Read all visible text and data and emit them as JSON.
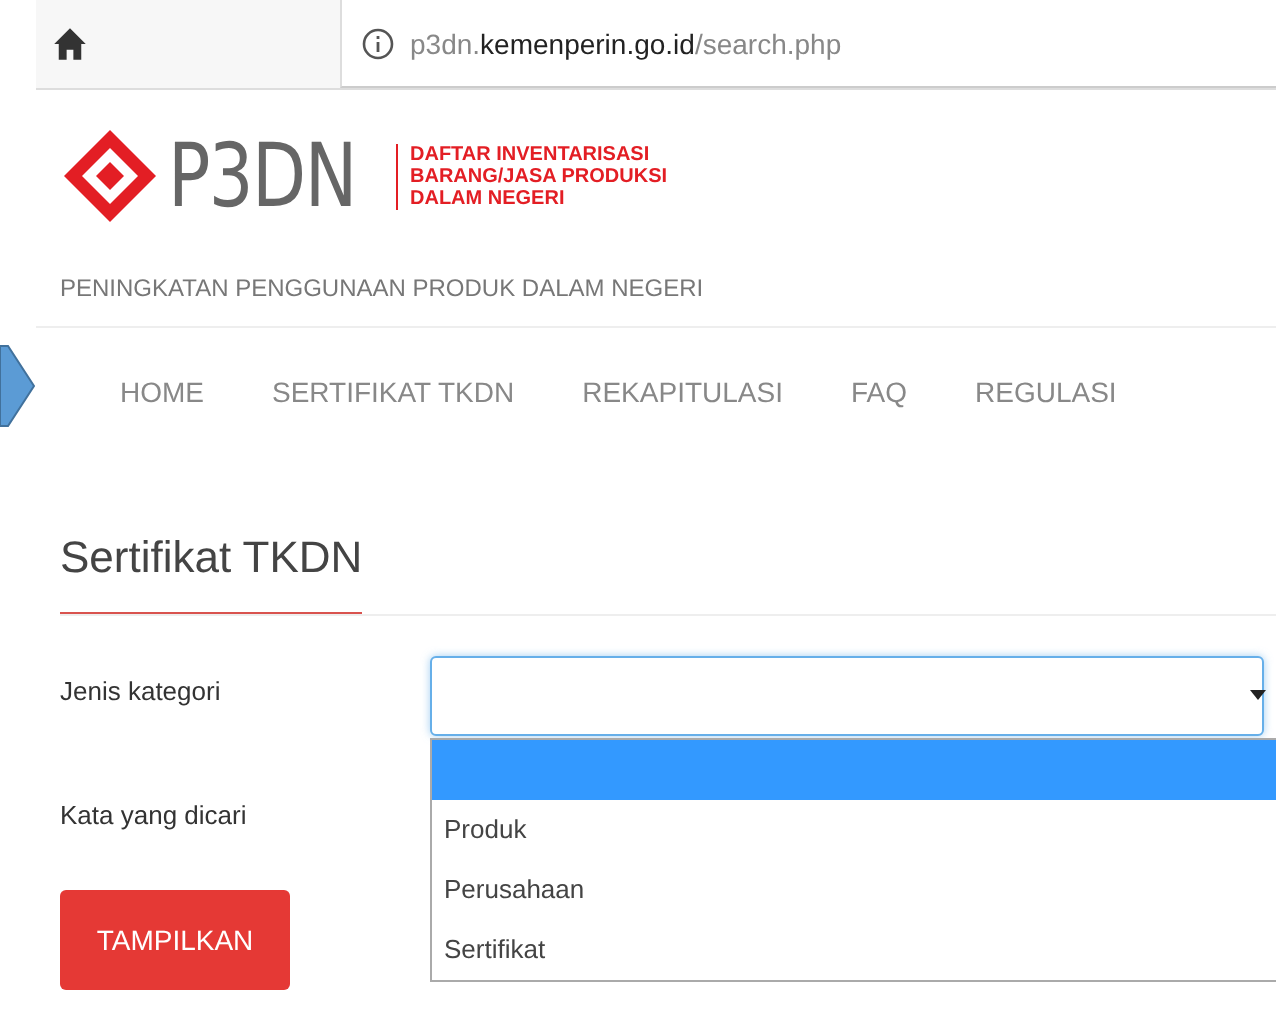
{
  "browser": {
    "url_parts": [
      {
        "text": "p3dn.",
        "kind": "dim"
      },
      {
        "text": "kemenperin.go.id",
        "kind": "host"
      },
      {
        "text": "/search.php",
        "kind": "dim"
      }
    ]
  },
  "logo": {
    "name": "P3DN",
    "lines": [
      "DAFTAR INVENTARISASI",
      "BARANG/JASA PRODUKSI",
      "DALAM NEGERI"
    ]
  },
  "tagline": "PENINGKATAN PENGGUNAAN PRODUK DALAM NEGERI",
  "nav": [
    "HOME",
    "SERTIFIKAT TKDN",
    "REKAPITULASI",
    "FAQ",
    "REGULASI"
  ],
  "heading": "Sertifikat TKDN",
  "form": {
    "fields": [
      {
        "label": "Jenis kategori",
        "kind": "select"
      },
      {
        "label": "Kata yang dicari",
        "kind": "text"
      }
    ],
    "options": [
      {
        "selected": true
      },
      {
        "label": "Produk",
        "selected": false
      },
      {
        "label": "Perusahaan",
        "selected": false
      },
      {
        "label": "Sertifikat",
        "selected": false
      }
    ],
    "button": "TAMPILKAN"
  }
}
